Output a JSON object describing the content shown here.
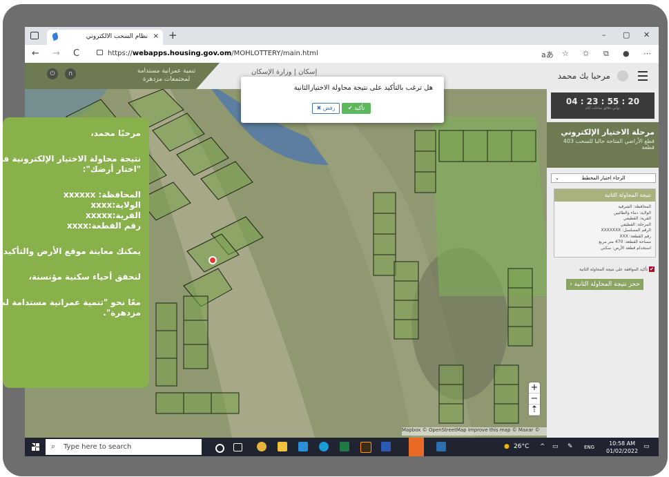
{
  "browser": {
    "tab_title": "نظام السحب الالكتروني",
    "tab_close": "×",
    "new_tab": "+",
    "url_host": "webapps.housing.gov.om",
    "url_prefix": "https://",
    "url_path": "/MOHLOTTERY/main.html",
    "minimize": "–",
    "maximize": "▢",
    "close": "✕",
    "back": "←",
    "forward": "→",
    "reload": "C"
  },
  "header": {
    "slogan_line1": "تنمية عمرانية مستدامة",
    "slogan_line2": "لمجتمعات مزدهرة",
    "logo_text": "إسكان | وزارة الإسكان",
    "greeting": "مرحبا بك محمد"
  },
  "modal": {
    "question": "هل ترغب بالتأكيد على نتيجة محاولة الاختيارالثانية",
    "confirm_label": "✔ تأكيد",
    "reject_label": "✖ رفض"
  },
  "panel": {
    "timer": "04 : 23 : 55 : 20",
    "timer_units": "ثواني  دقائق  ساعات  أيام",
    "stage_title": "مرحلة الاختيار الإلكتروني",
    "stage_desc": "قطع الأراضي المتاحة حاليا للسحب 403 قطعة",
    "select_label": "الرجاء اختيار المخطط",
    "result_title": "نتيجة المحاولة الثانية",
    "result_lines": [
      "المحافظة: الشرقية",
      "الولاية: دماء والطائيين",
      "القرية: القطيفي",
      "المرحلة: القطيفي",
      "الرقم المسلسل: XXXXXXX",
      "رقم القطعة: XXX",
      "مساحة القطعة: 470 متر مربع",
      "استخدام قطعة الأرض: سكني"
    ],
    "confirm_check": "تأكيد الموافقة على نتيجة المحاولة الثانية",
    "book_button": "حجز نتيجة المحاولة الثانية ‹"
  },
  "map": {
    "attribution": "Mapbox © OpenStreetMap Improve this map © Maxar ©",
    "zoom_in": "+",
    "zoom_out": "−",
    "compass": "⇡"
  },
  "overlay": {
    "line1": "مرحبًا محمد،",
    "line2": "نتيجة محاولة الاختيار الإلكترونية في حملة",
    "line3": "\"اختار أرضك\":",
    "line4": "المحافظة: xxxxxx",
    "line5": "الولاية:xxxx",
    "line6": "القرية:xxxxx",
    "line7": "رقم القطعة:xxxx",
    "line8": "يمكنك معاينة موقع الأرض والتأكيد عليها",
    "line9": "لنحقق أحياء سكنية مؤنسنة،",
    "line10": "معًا نحو \"تنمية عمرانية مستدامة لمجتمعات",
    "line11": "مزدهرة\"."
  },
  "taskbar": {
    "search_placeholder": "Type here to search",
    "temperature": "26°C",
    "lang": "ENG",
    "time": "10:58 AM",
    "date": "01/02/2022"
  },
  "colors": {
    "accent_green": "#88b04b",
    "header_olive": "#6e7a52",
    "confirm_green": "#5cb85c",
    "reject_blue": "#3a74b7"
  }
}
